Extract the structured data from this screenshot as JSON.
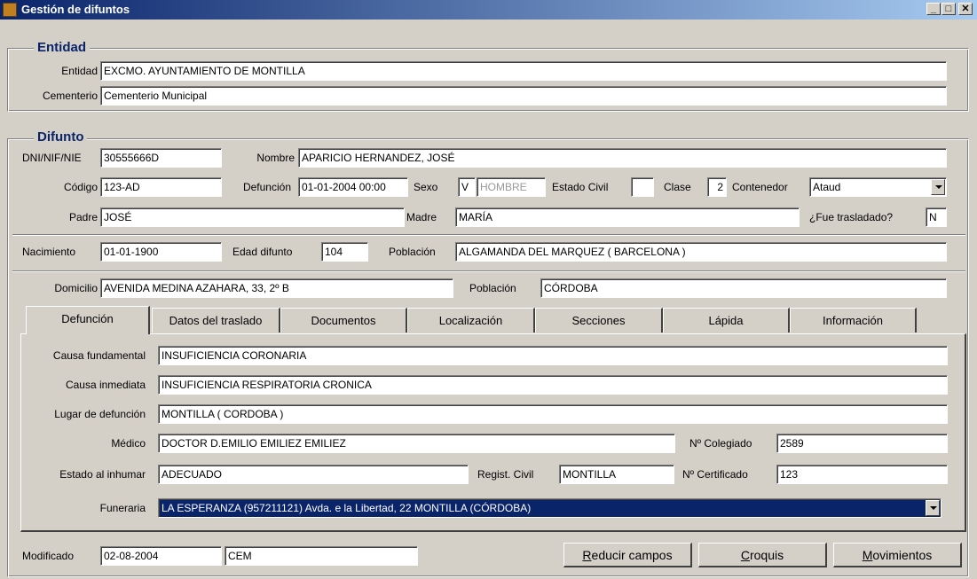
{
  "window": {
    "title": "Gestión de difuntos"
  },
  "entidad_group": {
    "title": "Entidad",
    "entidad_label": "Entidad",
    "entidad_value": "EXCMO. AYUNTAMIENTO DE MONTILLA",
    "cementerio_label": "Cementerio",
    "cementerio_value": "Cementerio Municipal"
  },
  "difunto_group": {
    "title": "Difunto",
    "dni_label": "DNI/NIF/NIE",
    "dni_value": "30555666D",
    "nombre_label": "Nombre",
    "nombre_value": "APARICIO HERNANDEZ, JOSÉ",
    "codigo_label": "Código",
    "codigo_value": "123-AD",
    "defuncion_label": "Defunción",
    "defuncion_value": "01-01-2004 00:00",
    "sexo_label": "Sexo",
    "sexo_code": "V",
    "sexo_text": "HOMBRE",
    "estado_civil_label": "Estado Civil",
    "estado_civil_value": "",
    "clase_label": "Clase",
    "clase_value": "2",
    "contenedor_label": "Contenedor",
    "contenedor_value": "Ataud",
    "padre_label": "Padre",
    "padre_value": "JOSÉ",
    "madre_label": "Madre",
    "madre_value": "MARÍA",
    "trasladado_label": "¿Fue trasladado?",
    "trasladado_value": "N",
    "nacimiento_label": "Nacimiento",
    "nacimiento_value": "01-01-1900",
    "edad_label": "Edad difunto",
    "edad_value": "104",
    "poblacion1_label": "Población",
    "poblacion1_value": "ALGAMANDA DEL MARQUEZ ( BARCELONA )",
    "domicilio_label": "Domicilio",
    "domicilio_value": "AVENIDA MEDINA AZAHARA, 33, 2º B",
    "poblacion2_label": "Población",
    "poblacion2_value": "CÓRDOBA"
  },
  "tabs": [
    "Defunción",
    "Datos del traslado",
    "Documentos",
    "Localización",
    "Secciones",
    "Lápida",
    "Información"
  ],
  "defuncion_tab": {
    "causa_fund_label": "Causa fundamental",
    "causa_fund_value": "INSUFICIENCIA CORONARIA",
    "causa_inm_label": "Causa inmediata",
    "causa_inm_value": "INSUFICIENCIA RESPIRATORIA CRONICA",
    "lugar_label": "Lugar de defunción",
    "lugar_value": "MONTILLA ( CORDOBA )",
    "medico_label": "Médico",
    "medico_value": "DOCTOR  D.EMILIO EMILIEZ EMILIEZ",
    "colegiado_label": "Nº Colegiado",
    "colegiado_value": "2589",
    "estado_label": "Estado al inhumar",
    "estado_value": "ADECUADO",
    "registro_label": "Regist. Civil",
    "registro_value": "MONTILLA",
    "certificado_label": "Nº Certificado",
    "certificado_value": "123",
    "funeraria_label": "Funeraria",
    "funeraria_value": "LA ESPERANZA (957211121) Avda. e la Libertad, 22 MONTILLA (CÓRDOBA)"
  },
  "footer": {
    "modificado_label": "Modificado",
    "modificado_value": "02-08-2004",
    "usuario_value": "CEM",
    "reducir_first": "R",
    "reducir_rest": "educir campos",
    "croquis_first": "C",
    "croquis_rest": "roquis",
    "movimientos_first": "M",
    "movimientos_rest": "ovimientos"
  }
}
